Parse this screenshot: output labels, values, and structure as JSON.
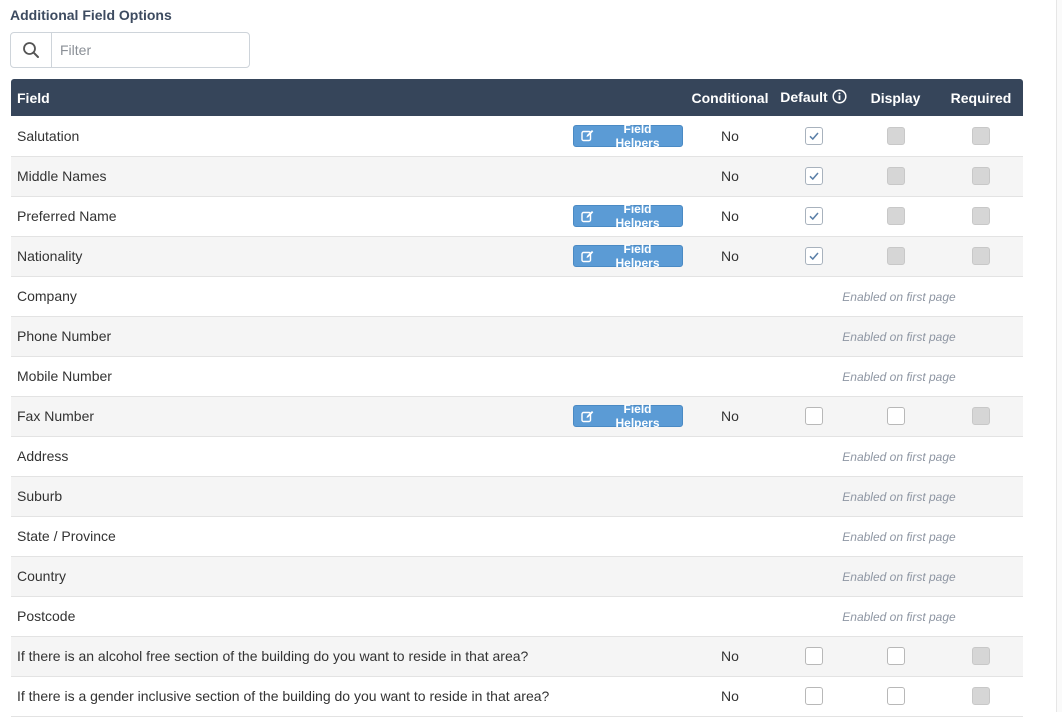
{
  "title": "Additional Field Options",
  "filter": {
    "placeholder": "Filter",
    "value": ""
  },
  "headers": {
    "field": "Field",
    "conditional": "Conditional",
    "default": "Default",
    "display": "Display",
    "required": "Required"
  },
  "helpers_label": "Field Helpers",
  "enabled_note": "Enabled on first page",
  "colors": {
    "header_bg": "#36455a",
    "button_bg": "#5b9bd5",
    "title": "#3d4b60",
    "check": "#5a7fa8"
  },
  "rows": [
    {
      "field": "Salutation",
      "helpers": true,
      "conditional": "No",
      "default": "checked",
      "display": "disabled",
      "required": "disabled"
    },
    {
      "field": "Middle Names",
      "helpers": false,
      "conditional": "No",
      "default": "checked",
      "display": "disabled",
      "required": "disabled"
    },
    {
      "field": "Preferred Name",
      "helpers": true,
      "conditional": "No",
      "default": "checked",
      "display": "disabled",
      "required": "disabled"
    },
    {
      "field": "Nationality",
      "helpers": true,
      "conditional": "No",
      "default": "checked",
      "display": "disabled",
      "required": "disabled"
    },
    {
      "field": "Company",
      "helpers": false,
      "enabled_on_first_page": true
    },
    {
      "field": "Phone Number",
      "helpers": false,
      "enabled_on_first_page": true
    },
    {
      "field": "Mobile Number",
      "helpers": false,
      "enabled_on_first_page": true
    },
    {
      "field": "Fax Number",
      "helpers": true,
      "conditional": "No",
      "default": "unchecked",
      "display": "unchecked",
      "required": "disabled"
    },
    {
      "field": "Address",
      "helpers": false,
      "enabled_on_first_page": true
    },
    {
      "field": "Suburb",
      "helpers": false,
      "enabled_on_first_page": true
    },
    {
      "field": "State / Province",
      "helpers": false,
      "enabled_on_first_page": true
    },
    {
      "field": "Country",
      "helpers": false,
      "enabled_on_first_page": true
    },
    {
      "field": "Postcode",
      "helpers": false,
      "enabled_on_first_page": true
    },
    {
      "field": "If there is an alcohol free section of the building do you want to reside in that area?",
      "helpers": false,
      "conditional": "No",
      "default": "unchecked",
      "display": "unchecked",
      "required": "disabled"
    },
    {
      "field": "If there is a gender inclusive section of the building do you want to reside in that area?",
      "helpers": false,
      "conditional": "No",
      "default": "unchecked",
      "display": "unchecked",
      "required": "disabled"
    }
  ]
}
